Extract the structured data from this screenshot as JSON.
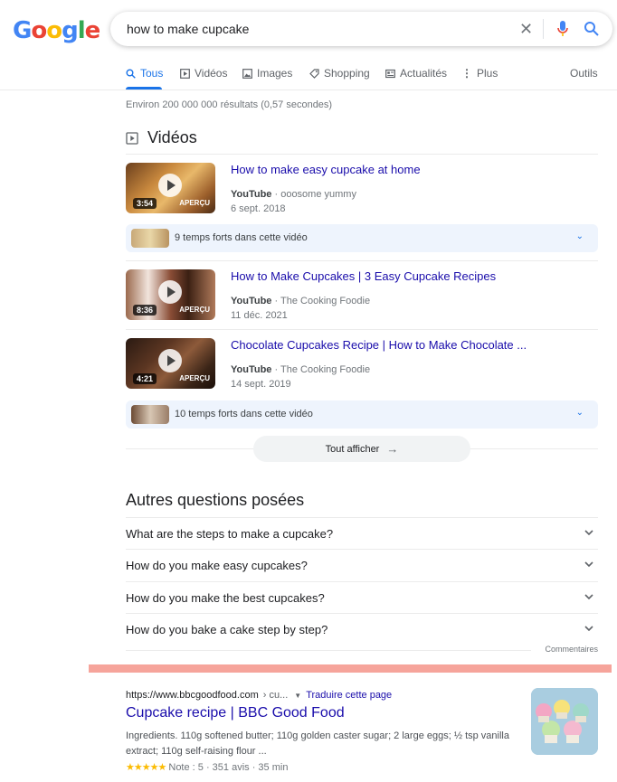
{
  "logo": {
    "letters": [
      "G",
      "o",
      "o",
      "g",
      "l",
      "e"
    ],
    "colors": [
      "#4285F4",
      "#EA4335",
      "#FBBC05",
      "#4285F4",
      "#34A853",
      "#EA4335"
    ]
  },
  "search": {
    "query": "how to make cupcake"
  },
  "tabs": [
    {
      "label": "Tous",
      "icon": "search-icon",
      "active": true
    },
    {
      "label": "Vidéos",
      "icon": "video-icon"
    },
    {
      "label": "Images",
      "icon": "image-icon"
    },
    {
      "label": "Shopping",
      "icon": "tag-icon"
    },
    {
      "label": "Actualités",
      "icon": "news-icon"
    },
    {
      "label": "Plus",
      "icon": "more-vert-icon"
    }
  ],
  "tools_label": "Outils",
  "stats": "Environ 200 000 000 résultats (0,57 secondes)",
  "videos": {
    "section_title": "Vidéos",
    "items": [
      {
        "title": "How to make easy cupcake at home",
        "source": "YouTube",
        "channel": "ooosome yummy",
        "date": "6 sept. 2018",
        "duration": "3:54",
        "apercu": "APERÇU"
      },
      {
        "title": "How to Make Cupcakes | 3 Easy Cupcake Recipes",
        "source": "YouTube",
        "channel": "The Cooking Foodie",
        "date": "11 déc. 2021",
        "duration": "8:36",
        "apercu": "APERÇU"
      },
      {
        "title": "Chocolate Cupcakes Recipe | How to Make Chocolate ...",
        "source": "YouTube",
        "channel": "The Cooking Foodie",
        "date": "14 sept. 2019",
        "duration": "4:21",
        "apercu": "APERÇU"
      }
    ],
    "moments": [
      "9 temps forts dans cette vidéo",
      "10 temps forts dans cette vidéo"
    ],
    "show_all": "Tout afficher"
  },
  "paa": {
    "title": "Autres questions posées",
    "questions": [
      "What are the steps to make a cupcake?",
      "How do you make easy cupcakes?",
      "How do you make the best cupcakes?",
      "How do you bake a cake step by step?"
    ],
    "feedback": "Commentaires"
  },
  "result": {
    "url": "https://www.bbcgoodfood.com",
    "crumb": "› cu...",
    "translate": "Traduire cette page",
    "title": "Cupcake recipe | BBC Good Food",
    "snippet": "Ingredients. 110g softened butter; 110g golden caster sugar; 2 large eggs; ½ tsp vanilla extract; 110g self-raising flour ...",
    "stars": "★★★★★",
    "rating": "Note : 5 · 351 avis · 35 min"
  }
}
